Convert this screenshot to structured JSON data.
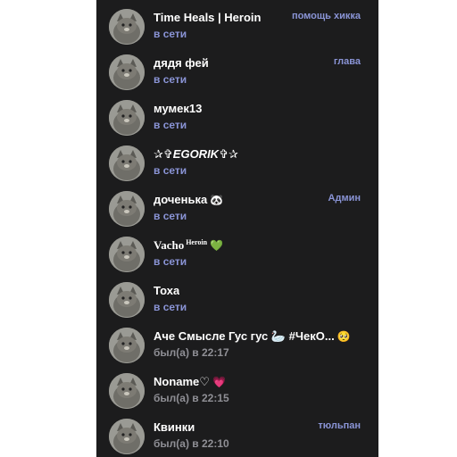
{
  "members": [
    {
      "name": "Time Heals | Heroin",
      "status": "в сети",
      "role": "помощь хикка",
      "emoji": "",
      "sup": ""
    },
    {
      "name": "дядя фей",
      "status": "в сети",
      "role": "глава",
      "emoji": "",
      "sup": ""
    },
    {
      "name": "мумек13",
      "status": "в сети",
      "role": "",
      "emoji": "",
      "sup": ""
    },
    {
      "name": "✰✞EGORIK✞✰",
      "status": "в сети",
      "role": "",
      "emoji": "",
      "sup": ""
    },
    {
      "name": "доченька",
      "status": "в сети",
      "role": "Админ",
      "emoji": "🐼",
      "sup": ""
    },
    {
      "name": "Vacho",
      "status": "в сети",
      "role": "",
      "emoji": "💚",
      "sup": "Heroin"
    },
    {
      "name": "Тоха",
      "status": "в сети",
      "role": "",
      "emoji": "",
      "sup": ""
    },
    {
      "name": "Аче Смысле Гус гус 🦢 #ЧекО...",
      "status": "был(а) в 22:17",
      "role": "",
      "emoji": "🥺",
      "sup": ""
    },
    {
      "name": "Noname♡",
      "status": "был(а) в 22:15",
      "role": "",
      "emoji": "💗",
      "sup": ""
    },
    {
      "name": "Квинки",
      "status": "был(а) в 22:10",
      "role": "тюльпан",
      "emoji": "",
      "sup": ""
    }
  ],
  "colors": {
    "background": "#1c1c1d",
    "online_status": "#8a94d6",
    "offline_status": "#8f8f95",
    "role": "#8a94d6",
    "name": "#ffffff"
  },
  "icons": {
    "avatar": "cat-avatar-icon"
  }
}
